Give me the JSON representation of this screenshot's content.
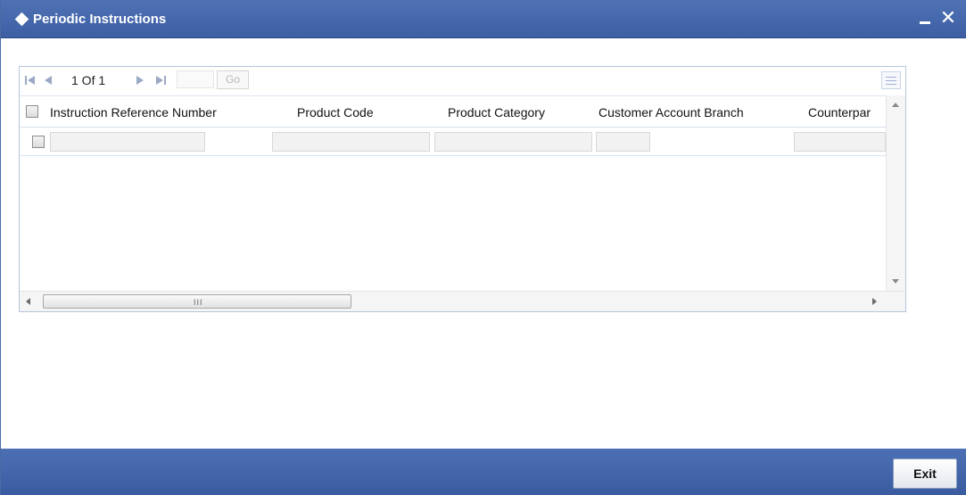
{
  "window": {
    "title": "Periodic Instructions",
    "colors": {
      "titlebar": "#4066ab",
      "footer": "#4466aa",
      "grid_border": "#b5c4dd"
    }
  },
  "pager": {
    "page_text": "1 Of 1",
    "go_label": "Go",
    "page_input_value": ""
  },
  "table": {
    "columns": [
      "Instruction Reference Number",
      "Product Code",
      "Product Category",
      "Customer Account Branch",
      "Counterpar"
    ],
    "rows": [
      {
        "checked": false,
        "cells": [
          "",
          "",
          "",
          "",
          ""
        ]
      }
    ],
    "header_checkbox_checked": false
  },
  "footer": {
    "exit_label": "Exit"
  },
  "icons": {
    "title": "diamond-icon",
    "minimize": "minimize-icon",
    "close": "close-icon",
    "first": "first-page-icon",
    "prev": "previous-page-icon",
    "next": "next-page-icon",
    "last": "last-page-icon",
    "view": "list-view-icon"
  }
}
